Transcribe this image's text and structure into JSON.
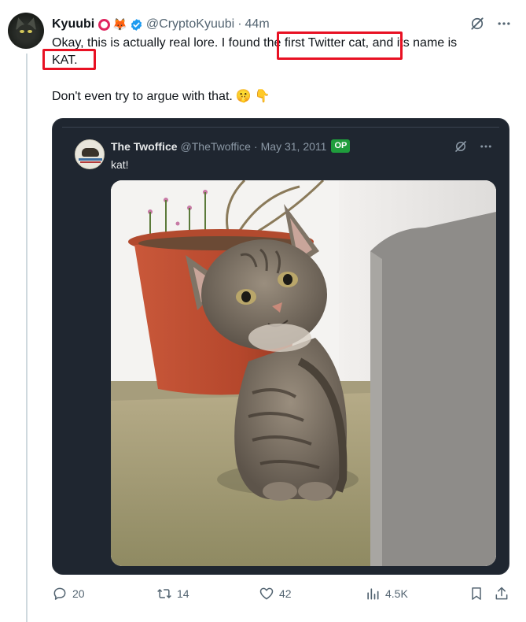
{
  "tweet": {
    "author_name": "Kyuubi",
    "author_handle": "@CryptoKyuubi",
    "separator": "·",
    "time_ago": "44m",
    "text_line1": "Okay, this is actually real lore. I found the first Twitter cat, and its name is",
    "text_line1b": "KAT.",
    "text_line2": "Don't even try to argue with that.",
    "emojis": [
      "🤫",
      "👇",
      "🦊"
    ]
  },
  "quote": {
    "author_name": "The Twoffice",
    "author_handle": "@TheTwoffice",
    "separator": "·",
    "date": "May 31, 2011",
    "badge": "OP",
    "text": "kat!"
  },
  "actions": {
    "replies": "20",
    "reposts": "14",
    "likes": "42",
    "views": "4.5K"
  },
  "colors": {
    "highlight": "#e81123",
    "verified": "#1d9bf0",
    "op_badge": "#1f9d3c",
    "quote_bg": "#1f2630"
  }
}
